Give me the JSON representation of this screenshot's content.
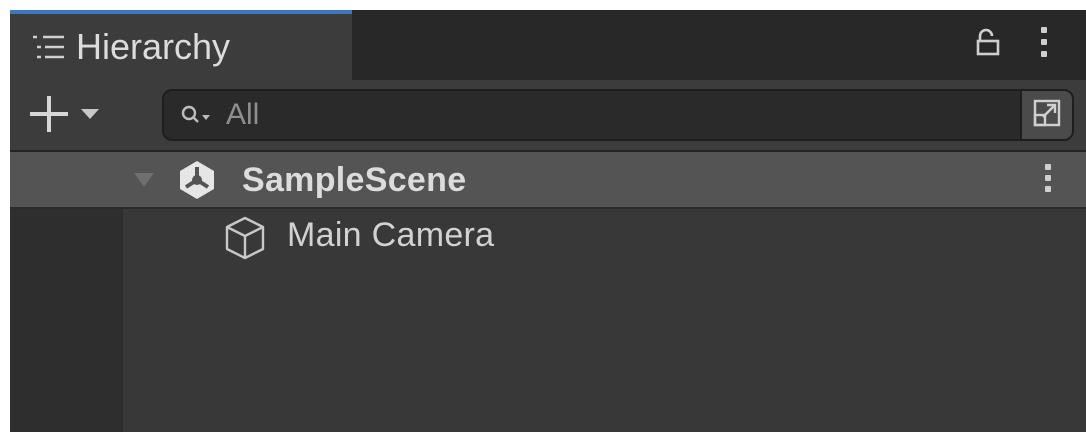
{
  "window": {
    "tab_title": "Hierarchy"
  },
  "toolbar": {
    "add_label": "+",
    "search_placeholder": "All"
  },
  "tree": {
    "scene": {
      "label": "SampleScene",
      "expanded": true
    },
    "items": [
      {
        "label": "Main Camera",
        "icon": "cube-icon"
      }
    ]
  },
  "colors": {
    "panel_bg": "#383838",
    "tab_accent": "#3a79bb",
    "scene_row_bg": "#545454",
    "text": "#d2d2d2"
  }
}
